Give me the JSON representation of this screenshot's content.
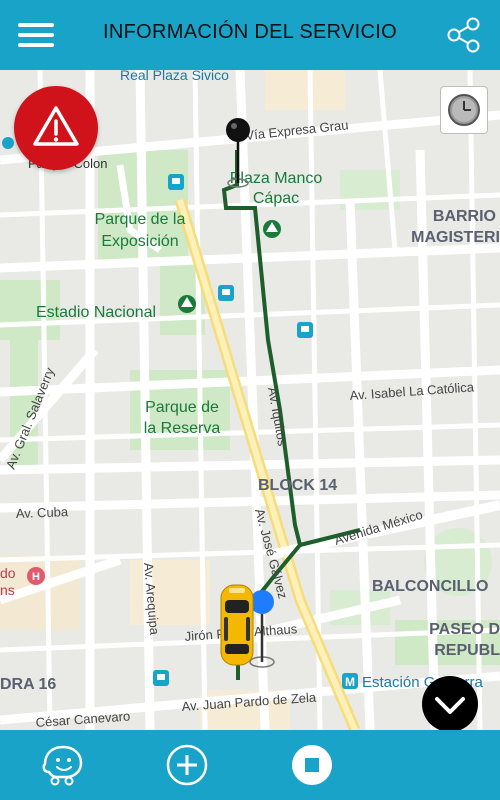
{
  "header": {
    "title": "INFORMACIÓN DEL SERVICIO",
    "menu_icon": "hamburger-menu-icon",
    "share_icon": "share-icon"
  },
  "map": {
    "places": {
      "plaza_manco_1": "Plaza Manco",
      "plaza_manco_2": "Cápac",
      "parque_exposicion_1": "Parque de la",
      "parque_exposicion_2": "Exposición",
      "estadio_nacional": "Estadio Nacional",
      "parque_reserva_1": "Parque de",
      "parque_reserva_2": "la Reserva",
      "barrio_1": "BARRIO",
      "barrio_2": "MAGISTERI",
      "block14": "BLOCK 14",
      "balconcillo": "BALCONCILLO",
      "paseo_1": "PASEO D",
      "paseo_2": "REPUBL",
      "dra16": "DRA 16",
      "top_cut": "Real Plaza Sivico",
      "park_colon_cut": "Parque Colon",
      "hosp_1": "do",
      "hosp_2": "ns"
    },
    "streets": {
      "via_expresa_grau": "Vía Expresa Grau",
      "isabel_catolica": "Av. Isabel La Católica",
      "iquitos": "Av. Iquitos",
      "gral_salaverry": "Av. Gral. Salaverry",
      "cuba": "Av. Cuba",
      "jose_galvez": "Av. José Gálvez",
      "avenida_mexico": "Avenida México",
      "arequipa": "Av. Arequipa",
      "jiron_althaus": "Jirón Pedro Althaus",
      "pardo_zela": "Av. Juan Pardo de Zela",
      "cesar_canevaro": "César Canevaro",
      "estacion": "Estación Gamarra"
    },
    "colors": {
      "route": "#1e5e2a",
      "alert_red": "#d0121b",
      "header_blue": "#1aa3c9",
      "taxi_yellow": "#f5b800",
      "poi_green": "#1a7a3c",
      "pin_blue": "#1f7cff"
    }
  },
  "buttons": {
    "alert_icon": "alert-triangle-icon",
    "clock_icon": "clock-icon",
    "expand_icon": "chevron-down-icon",
    "waze_icon": "waze-icon",
    "add_icon": "add-circle-icon",
    "stop_icon": "stop-icon"
  }
}
